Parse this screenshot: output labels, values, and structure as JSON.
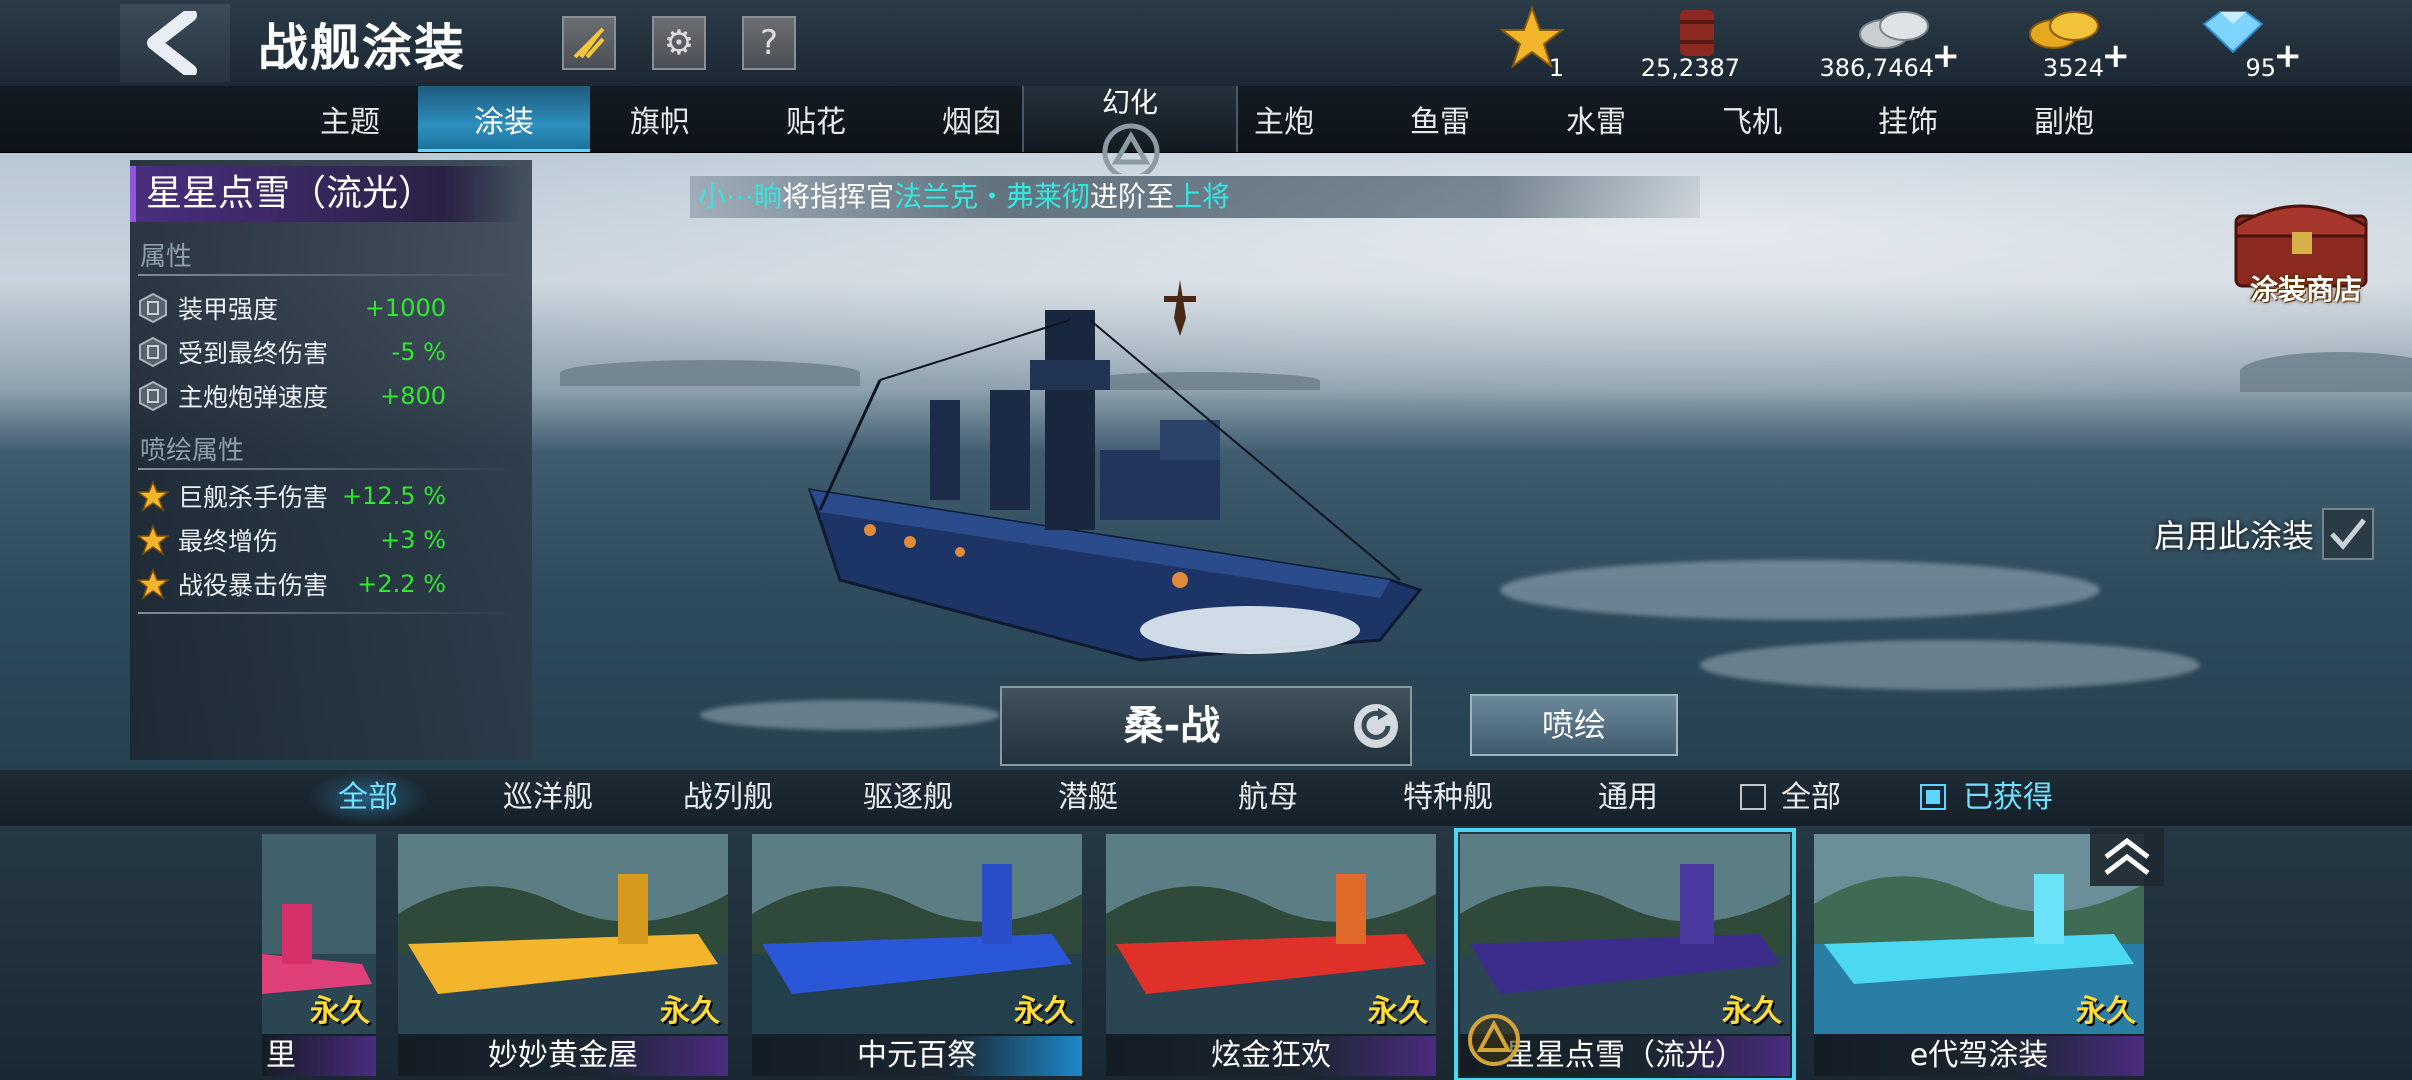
{
  "header": {
    "title": "战舰涂装",
    "resources": [
      {
        "icon": "star-icon",
        "value": "1",
        "plus": false
      },
      {
        "icon": "oil-barrel-icon",
        "value": "25,2387",
        "plus": false
      },
      {
        "icon": "silver-coins-icon",
        "value": "386,7464",
        "plus": true
      },
      {
        "icon": "gold-coins-icon",
        "value": "3524",
        "plus": true
      },
      {
        "icon": "diamond-icon",
        "value": "95",
        "plus": true
      }
    ]
  },
  "tabs": {
    "left": [
      "主题",
      "涂装",
      "旗帜",
      "贴花",
      "烟囱"
    ],
    "center": "幻化",
    "right": [
      "主炮",
      "鱼雷",
      "水雷",
      "飞机",
      "挂饰",
      "副炮"
    ],
    "active": "涂装"
  },
  "skin_panel": {
    "title": "星星点雪（流光）",
    "attr_header": "属性",
    "attrs": [
      {
        "name": "装甲强度",
        "value": "+1000"
      },
      {
        "name": "受到最终伤害",
        "value": "-5 %"
      },
      {
        "name": "主炮炮弹速度",
        "value": "+800"
      }
    ],
    "spray_header": "喷绘属性",
    "spray_attrs": [
      {
        "name": "巨舰杀手伤害",
        "value": "+12.5 %"
      },
      {
        "name": "最终增伤",
        "value": "+3 %"
      },
      {
        "name": "战役暴击伤害",
        "value": "+2.2 %"
      }
    ]
  },
  "notice": {
    "p1": "小⋯晌",
    "p2": "将指挥官",
    "p3": "法兰克・弗莱彻",
    "p4": "进阶至",
    "p5": "上将"
  },
  "shop_label": "涂装商店",
  "apply_label": "启用此涂装",
  "ship_name": "桑-战",
  "spray_button": "喷绘",
  "filters": {
    "tabs": [
      "全部",
      "巡洋舰",
      "战列舰",
      "驱逐舰",
      "潜艇",
      "航母",
      "特种舰",
      "通用"
    ],
    "active": "全部",
    "check_all": "全部",
    "check_owned": "已获得"
  },
  "cards": {
    "partial_name": "里",
    "items": [
      {
        "name": "妙妙黄金屋",
        "tag": "永久"
      },
      {
        "name": "中元百祭",
        "tag": "永久"
      },
      {
        "name": "炫金狂欢",
        "tag": "永久"
      },
      {
        "name": "星星点雪（流光）",
        "tag": "永久"
      },
      {
        "name": "e代驾涂装",
        "tag": "永久"
      }
    ],
    "partial_tag": "永久"
  },
  "colors": {
    "accent": "#2c90be",
    "positive": "#2fe82f",
    "highlight": "#35e6e0",
    "tag": "#ffdc33"
  }
}
